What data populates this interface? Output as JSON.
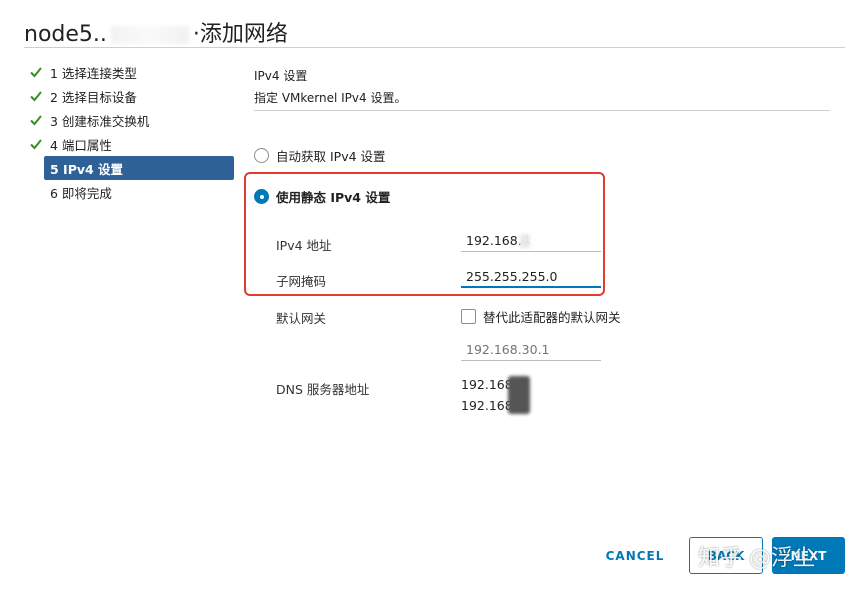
{
  "window": {
    "title_prefix": "node5..",
    "title_suffix": "·添加网络"
  },
  "steps": [
    {
      "label": "1 选择连接类型",
      "status": "done"
    },
    {
      "label": "2 选择目标设备",
      "status": "done"
    },
    {
      "label": "3 创建标准交换机",
      "status": "done"
    },
    {
      "label": "4 端口属性",
      "status": "done"
    },
    {
      "label": "5 IPv4 设置",
      "status": "active"
    },
    {
      "label": "6 即将完成",
      "status": "pending"
    }
  ],
  "section": {
    "title": "IPv4 设置",
    "description": "指定 VMkernel IPv4 设置。"
  },
  "options": {
    "auto_label": "自动获取 IPv4 设置",
    "static_label": "使用静态 IPv4 设置",
    "selected": "static"
  },
  "fields": {
    "ipv4_label": "IPv4 地址",
    "ipv4_value": "192.168.4",
    "subnet_label": "子网掩码",
    "subnet_value": "255.255.255.0",
    "gateway_label": "默认网关",
    "gateway_override_label": "替代此适配器的默认网关",
    "gateway_placeholder": "192.168.30.1",
    "dns_label": "DNS 服务器地址",
    "dns_values": [
      "192.168      4",
      "192.168      5"
    ]
  },
  "buttons": {
    "cancel": "CANCEL",
    "back": "BACK",
    "next": "NEXT"
  },
  "watermark": "知乎 @浮尘",
  "colors": {
    "accent": "#0079b8",
    "active_step": "#2e6296",
    "check": "#3c8d28",
    "highlight": "#e03c31"
  }
}
